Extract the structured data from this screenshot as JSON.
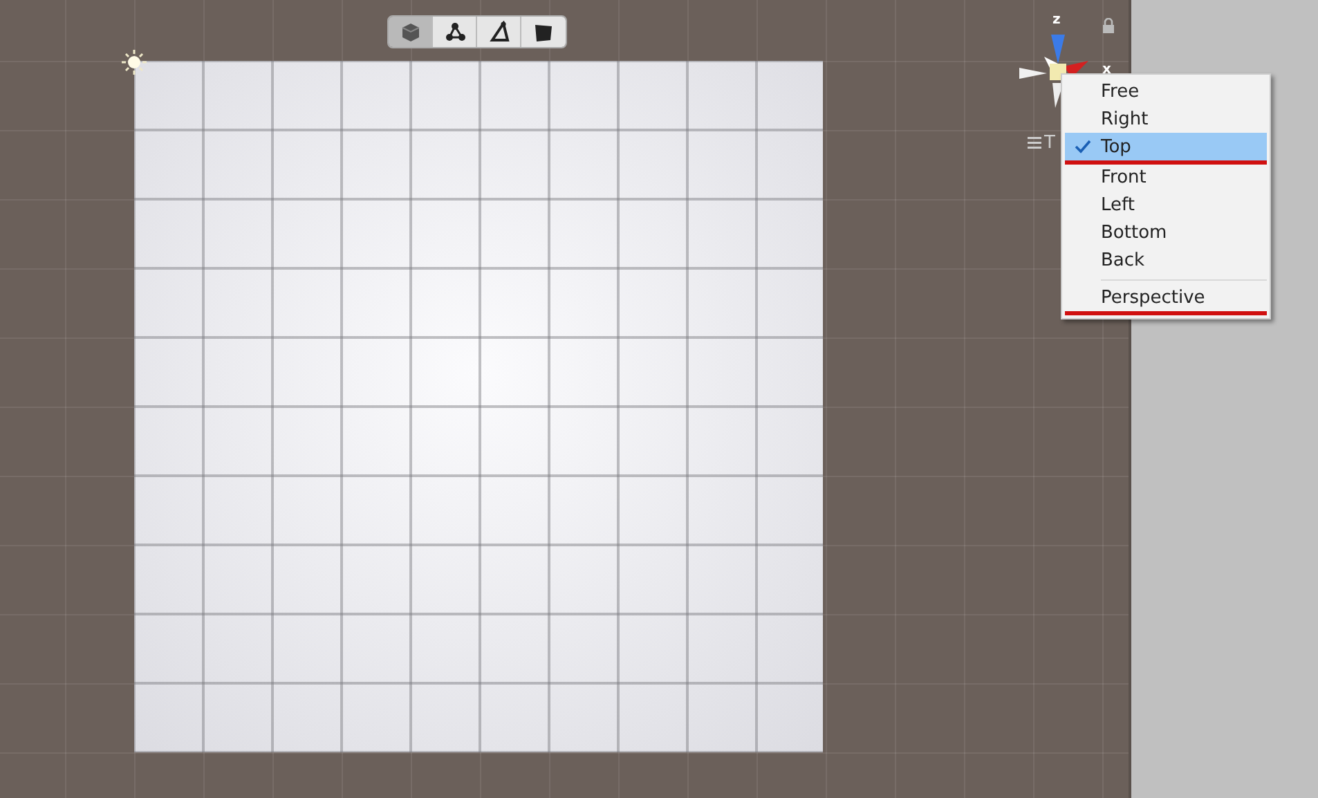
{
  "toolbar": {
    "buttons": [
      {
        "kind": "cube",
        "selected": true
      },
      {
        "kind": "nodes",
        "selected": false
      },
      {
        "kind": "triangle",
        "selected": false
      },
      {
        "kind": "shape",
        "selected": false
      }
    ]
  },
  "gizmo": {
    "axis_labels": [
      {
        "kind": "z",
        "text": "z"
      },
      {
        "kind": "x",
        "text": "x"
      }
    ],
    "view_label": "T"
  },
  "view_menu": {
    "items": [
      {
        "label": "Free",
        "selected": false,
        "underlined": false,
        "separator_before": false
      },
      {
        "label": "Right",
        "selected": false,
        "underlined": false,
        "separator_before": false
      },
      {
        "label": "Top",
        "selected": true,
        "underlined": true,
        "separator_before": false
      },
      {
        "label": "Front",
        "selected": false,
        "underlined": false,
        "separator_before": false
      },
      {
        "label": "Left",
        "selected": false,
        "underlined": false,
        "separator_before": false
      },
      {
        "label": "Bottom",
        "selected": false,
        "underlined": false,
        "separator_before": false
      },
      {
        "label": "Back",
        "selected": false,
        "underlined": false,
        "separator_before": false
      },
      {
        "label": "Perspective",
        "selected": false,
        "underlined": true,
        "separator_before": true
      }
    ]
  }
}
